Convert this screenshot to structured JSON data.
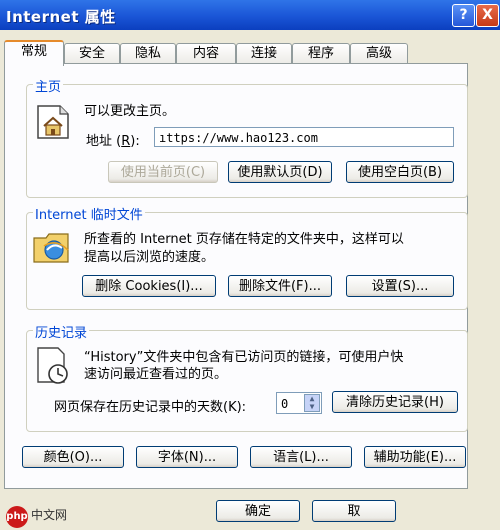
{
  "window": {
    "title": "Internet 属性",
    "help_button": "?",
    "close_button": "X"
  },
  "tabs": [
    {
      "label": "常规",
      "active": true
    },
    {
      "label": "安全"
    },
    {
      "label": "隐私"
    },
    {
      "label": "内容"
    },
    {
      "label": "连接"
    },
    {
      "label": "程序"
    },
    {
      "label": "高级"
    }
  ],
  "homepage": {
    "title": "主页",
    "description": "可以更改主页。",
    "address_label_prefix": "地址 (",
    "address_label_key": "R",
    "address_label_suffix": "):",
    "address_value": "ıttps://www.hao123.com",
    "buttons": {
      "use_current": "使用当前页(C)",
      "use_default": "使用默认页(D)",
      "use_blank": "使用空白页(B)"
    }
  },
  "temp_files": {
    "title": "Internet 临时文件",
    "description_line1": "所查看的 Internet 页存储在特定的文件夹中，这样可以",
    "description_line2": "提高以后浏览的速度。",
    "buttons": {
      "delete_cookies": "删除 Cookies(I)...",
      "delete_files": "删除文件(F)...",
      "settings": "设置(S)..."
    }
  },
  "history": {
    "title": "历史记录",
    "description_line1": "“History”文件夹中包含有已访问页的链接，可使用户快",
    "description_line2": "速访问最近查看过的页。",
    "days_label": "网页保存在历史记录中的天数(K):",
    "days_value": "0",
    "clear_button": "清除历史记录(H)"
  },
  "bottom_buttons": {
    "colors": "颜色(O)...",
    "fonts": "字体(N)...",
    "languages": "语言(L)...",
    "accessibility": "辅助功能(E)..."
  },
  "dialog_buttons": {
    "ok": "确定",
    "cancel": "取"
  },
  "watermark": {
    "logo": "php",
    "text": "中文网"
  }
}
